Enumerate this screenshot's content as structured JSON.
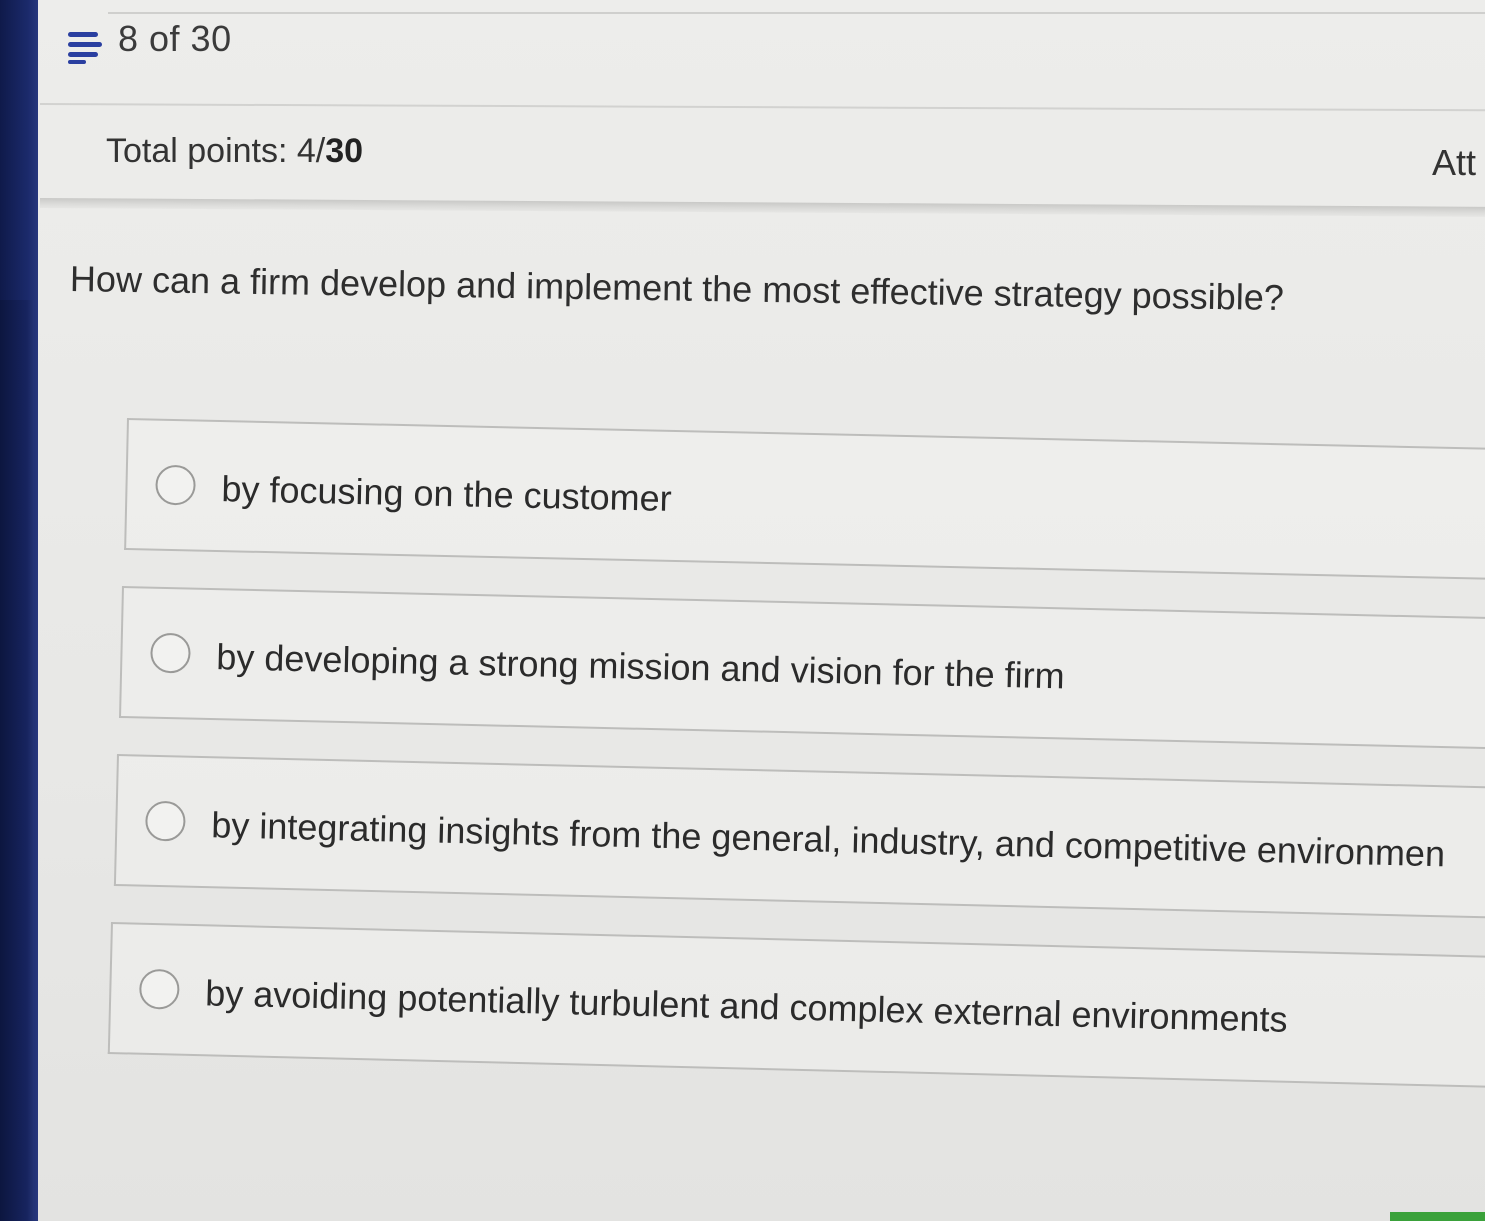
{
  "header": {
    "progress": "8 of 30",
    "menu_icon": "list-menu-icon"
  },
  "points": {
    "label": "Total points: 4/",
    "total": "30",
    "attempt_label": "Att"
  },
  "question": {
    "text": "How can a firm develop and implement the most effective strategy possible?"
  },
  "options": [
    {
      "label": "by focusing on the customer",
      "selected": false
    },
    {
      "label": "by developing a strong mission and vision for the firm",
      "selected": false
    },
    {
      "label": "by integrating insights from the general, industry, and competitive environmen",
      "selected": false
    },
    {
      "label": "by avoiding potentially turbulent and complex external environments",
      "selected": false
    }
  ],
  "colors": {
    "bezel": "#1b2a6b",
    "screen_bg": "#e9e9e7",
    "text": "#2b2b2b",
    "accent_green": "#3aa13a"
  }
}
